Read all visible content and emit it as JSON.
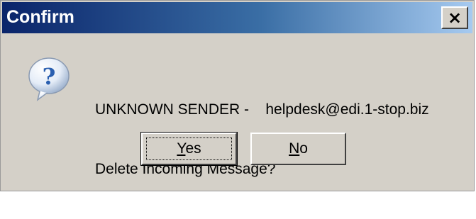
{
  "window": {
    "title": "Confirm",
    "close_label": "×"
  },
  "icon": {
    "name": "question-icon",
    "glyph": "?"
  },
  "message": {
    "line1": "UNKNOWN SENDER -    helpdesk@edi.1-stop.biz",
    "line2": "Delete Incoming Message?"
  },
  "buttons": {
    "yes": {
      "mnemonic": "Y",
      "rest": "es"
    },
    "no": {
      "mnemonic": "N",
      "rest": "o"
    }
  },
  "colors": {
    "title_start": "#0a246a",
    "title_end": "#a6caf0",
    "face": "#d4d0c8",
    "icon_blue": "#2a5fb0"
  }
}
